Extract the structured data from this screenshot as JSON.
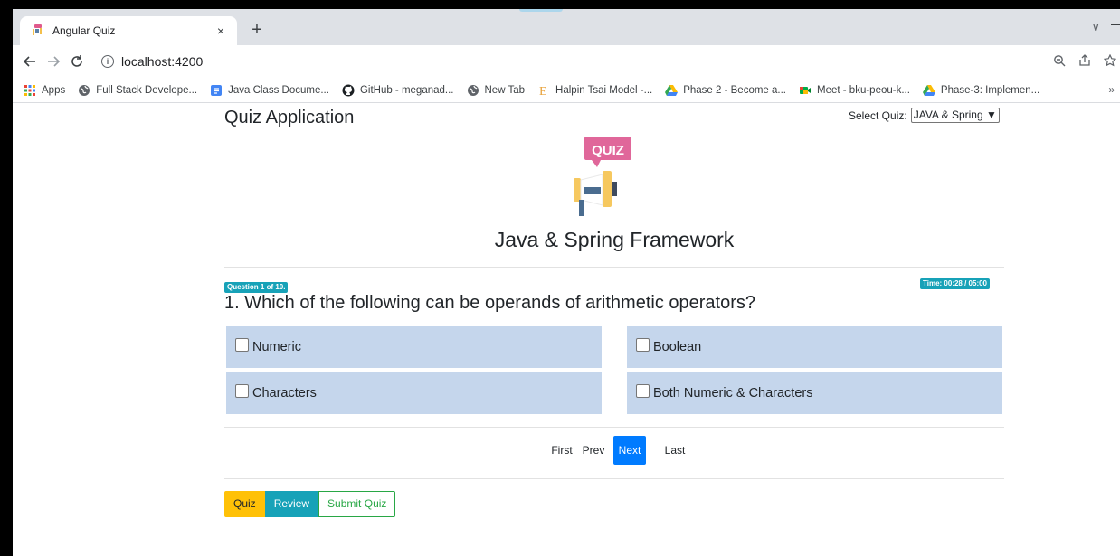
{
  "browser": {
    "tab_title": "Angular Quiz",
    "tab_close": "×",
    "new_tab": "+",
    "tab_search": "∨",
    "url": "localhost:4200",
    "bookmarks": [
      {
        "label": "Apps",
        "icon": "apps-grid-icon"
      },
      {
        "label": "Full Stack Develope...",
        "icon": "globe-icon"
      },
      {
        "label": "Java Class Docume...",
        "icon": "docs-icon"
      },
      {
        "label": "GitHub - meganad...",
        "icon": "github-icon"
      },
      {
        "label": "New Tab",
        "icon": "globe-icon"
      },
      {
        "label": "Halpin Tsai Model -...",
        "icon": "e-letter-icon"
      },
      {
        "label": "Phase 2 - Become a...",
        "icon": "drive-icon"
      },
      {
        "label": "Meet - bku-peou-k...",
        "icon": "meet-icon"
      },
      {
        "label": "Phase-3: Implemen...",
        "icon": "drive-icon"
      }
    ],
    "bookmarks_more": "»"
  },
  "app": {
    "title": "Quiz Application",
    "select_label": "Select Quiz:",
    "select_value": "JAVA & Spring",
    "logo_text": "QUIZ",
    "quiz_name": "Java & Spring Framework"
  },
  "question": {
    "counter": "Question 1 of 10.",
    "timer": "Time: 00:28 / 05:00",
    "text": "1. Which of the following can be operands of arithmetic operators?",
    "options": [
      "Numeric",
      "Boolean",
      "Characters",
      "Both Numeric & Characters"
    ]
  },
  "pager": {
    "first": "First",
    "prev": "Prev",
    "next": "Next",
    "last": "Last"
  },
  "modes": {
    "quiz": "Quiz",
    "review": "Review",
    "submit": "Submit Quiz"
  },
  "colors": {
    "option_bg": "#c5d6ec",
    "badge": "#17a2b8",
    "primary": "#007bff",
    "warning": "#ffc107",
    "success": "#28a745"
  }
}
